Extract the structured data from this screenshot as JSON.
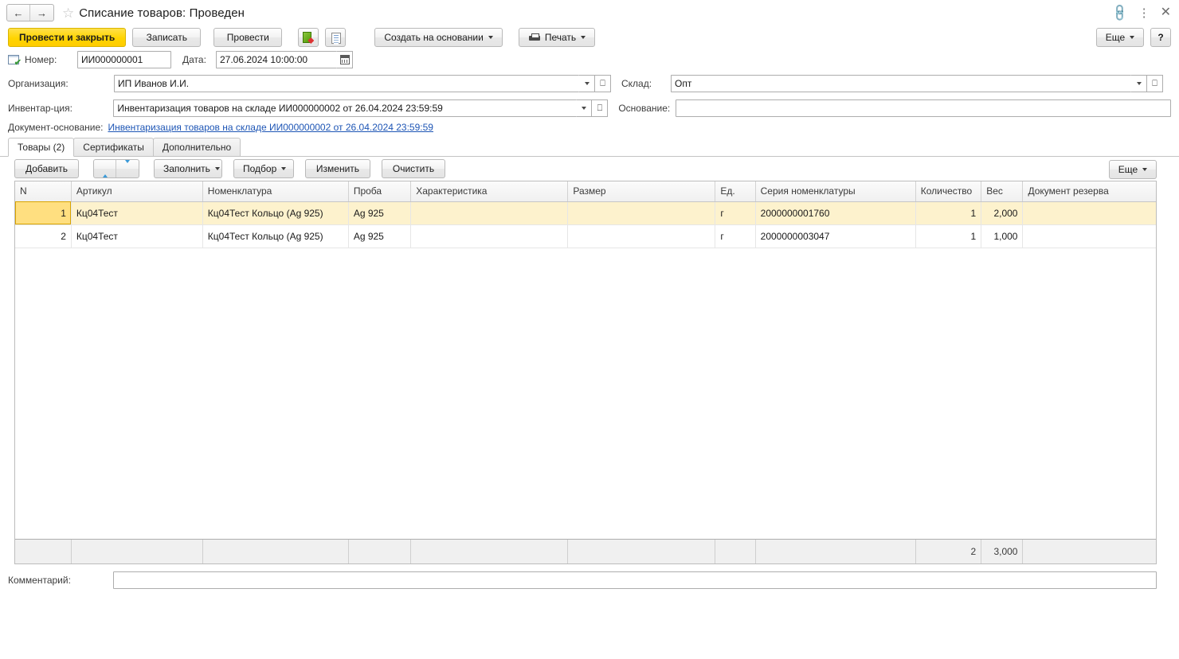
{
  "titlebar": {
    "back_label": "←",
    "forward_label": "→",
    "favorite_icon": "☆",
    "title": "Списание товаров: Проведен",
    "link_icon": "link-icon",
    "menu_icon": "⋮",
    "close_icon": "✕"
  },
  "commandbar": {
    "post_and_close": "Провести и закрыть",
    "write": "Записать",
    "post": "Провести",
    "fill_icon_name": "movements-icon",
    "report_icon_name": "report-icon",
    "create_based_on": "Создать на основании",
    "print": "Печать",
    "more": "Еще",
    "help": "?"
  },
  "header_fields": {
    "number_label": "Номер:",
    "number_value": "ИИ000000001",
    "date_label": "Дата:",
    "date_value": "27.06.2024 10:00:00",
    "organization_label": "Организация:",
    "organization_value": "ИП Иванов И.И.",
    "warehouse_label": "Склад:",
    "warehouse_value": "Опт",
    "inventory_label": "Инвентар-ция:",
    "inventory_value": "Инвентаризация товаров на складе ИИ000000002 от 26.04.2024 23:59:59",
    "basis_label": "Основание:",
    "basis_value": "",
    "basis_doc_label": "Документ-основание:",
    "basis_doc_link": "Инвентаризация товаров на складе ИИ000000002 от 26.04.2024 23:59:59"
  },
  "tabs": [
    {
      "label": "Товары (2)",
      "active": true
    },
    {
      "label": "Сертификаты",
      "active": false
    },
    {
      "label": "Дополнительно",
      "active": false
    }
  ],
  "table_toolbar": {
    "add": "Добавить",
    "move_up_icon": "arrow-up-icon",
    "move_down_icon": "arrow-down-icon",
    "fill": "Заполнить",
    "select": "Подбор",
    "change": "Изменить",
    "clear": "Очистить",
    "more": "Еще"
  },
  "grid": {
    "columns": [
      "N",
      "Артикул",
      "Номенклатура",
      "Проба",
      "Характеристика",
      "Размер",
      "Ед.",
      "Серия номенклатуры",
      "Количество",
      "Вес",
      "Документ резерва"
    ],
    "rows": [
      {
        "selected": true,
        "n": "1",
        "article": "Кц04Тест",
        "nomenclature": "Кц04Тест Кольцо (Ag 925)",
        "assay": "Ag 925",
        "characteristic": "",
        "size": "",
        "unit": "г",
        "series": "2000000001760",
        "quantity": "1",
        "weight": "2,000",
        "reserve_doc": ""
      },
      {
        "selected": false,
        "n": "2",
        "article": "Кц04Тест",
        "nomenclature": "Кц04Тест Кольцо (Ag 925)",
        "assay": "Ag 925",
        "characteristic": "",
        "size": "",
        "unit": "г",
        "series": "2000000003047",
        "quantity": "1",
        "weight": "1,000",
        "reserve_doc": ""
      }
    ],
    "totals": {
      "quantity": "2",
      "weight": "3,000"
    }
  },
  "footer": {
    "comment_label": "Комментарий:",
    "comment_value": ""
  },
  "colors": {
    "accent_yellow": "#ffd400",
    "selection_row": "#fdf2cd",
    "selection_cell": "#ffdf80",
    "link": "#1d55b5"
  }
}
